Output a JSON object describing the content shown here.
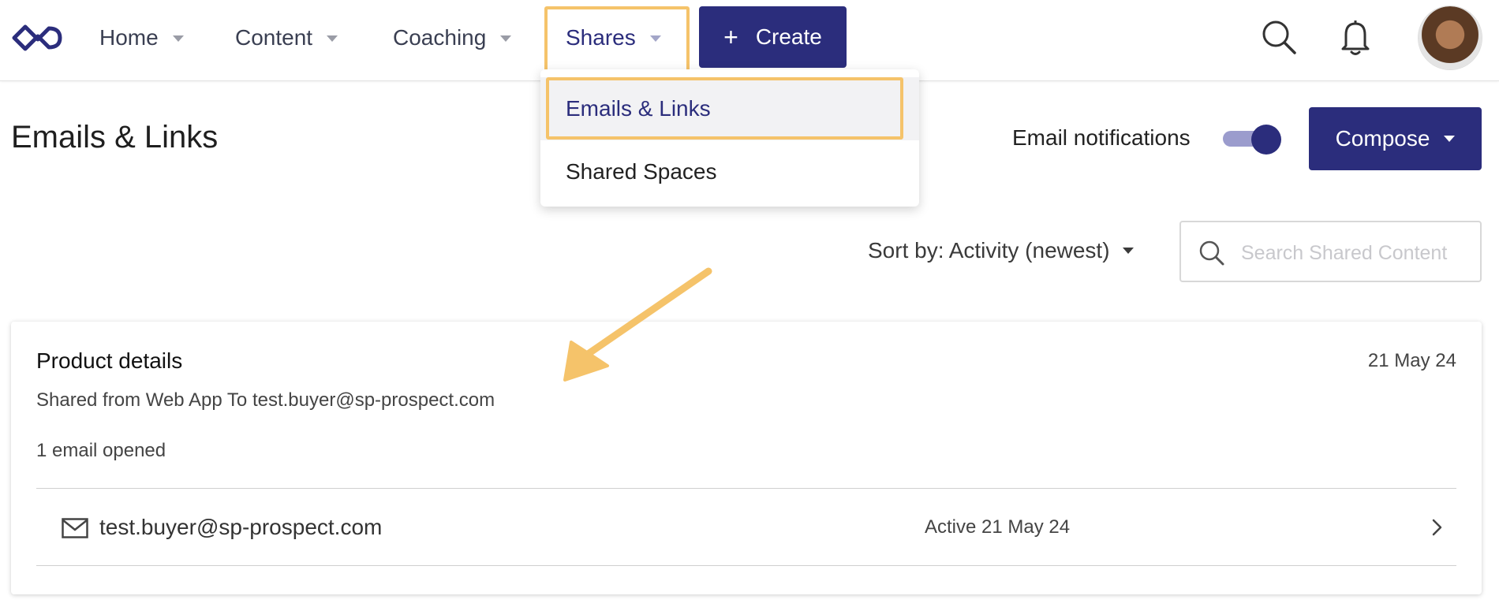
{
  "nav": {
    "items": [
      {
        "label": "Home"
      },
      {
        "label": "Content"
      },
      {
        "label": "Coaching"
      },
      {
        "label": "Shares"
      }
    ],
    "create_label": "Create"
  },
  "shares_menu": {
    "items": [
      {
        "label": "Emails & Links"
      },
      {
        "label": "Shared Spaces"
      }
    ]
  },
  "page": {
    "title": "Emails & Links",
    "email_notifications_label": "Email notifications",
    "email_notifications_on": true,
    "compose_label": "Compose",
    "sort_label": "Sort by: Activity (newest)",
    "search_placeholder": "Search Shared Content"
  },
  "share": {
    "title": "Product details",
    "date": "21 May 24",
    "subtitle": "Shared from Web App To test.buyer@sp-prospect.com",
    "opened": "1 email opened",
    "recipient": {
      "email": "test.buyer@sp-prospect.com",
      "status": "Active 21 May 24"
    }
  },
  "colors": {
    "brand": "#2b2d7c",
    "highlight": "#f5c36a"
  },
  "icons": [
    "logo-icon",
    "search-icon",
    "bell-icon",
    "avatar",
    "mail-icon",
    "chevron-right-icon",
    "arrow-annotation"
  ]
}
